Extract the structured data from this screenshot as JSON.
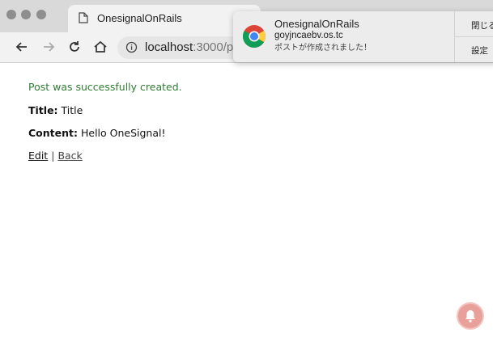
{
  "browser": {
    "tab_title": "OnesignalOnRails",
    "url_host": "localhost",
    "url_rest": ":3000/p"
  },
  "page": {
    "notice": "Post was successfully created.",
    "title_label": "Title:",
    "title_value": "Title",
    "content_label": "Content:",
    "content_value": "Hello OneSignal!",
    "edit_link": "Edit",
    "separator": "|",
    "back_link": "Back"
  },
  "notification": {
    "title": "OnesignalOnRails",
    "origin": "goyjncaebv.os.tc",
    "message": "ポストが作成されました！",
    "close_button": "閉じる",
    "settings_button": "設定",
    "icon": "chrome-icon"
  },
  "widget": {
    "icon": "bell-icon",
    "color": "#e8a09a"
  },
  "colors": {
    "notice": "#2e7d32",
    "tabstrip": "#d9d9d9",
    "toolbar": "#f2f2f2"
  }
}
